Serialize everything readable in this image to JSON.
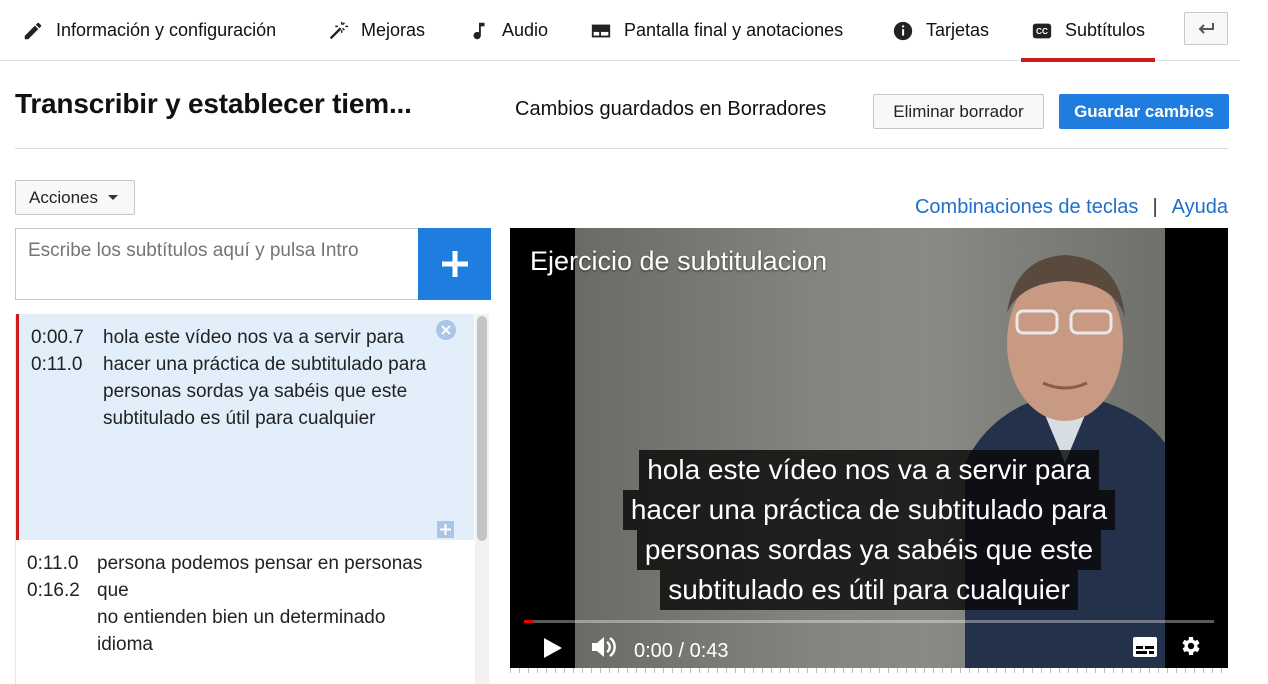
{
  "tabs": [
    {
      "label": "Información y configuración",
      "icon": "pencil-icon"
    },
    {
      "label": "Mejoras",
      "icon": "magic-wand-icon"
    },
    {
      "label": "Audio",
      "icon": "music-note-icon"
    },
    {
      "label": "Pantalla final y anotaciones",
      "icon": "end-screen-icon"
    },
    {
      "label": "Tarjetas",
      "icon": "info-icon"
    },
    {
      "label": "Subtítulos",
      "icon": "cc-icon",
      "active": true
    }
  ],
  "header": {
    "title": "Transcribir y establecer tiem...",
    "status": "Cambios guardados en Borradores",
    "delete_label": "Eliminar borrador",
    "save_label": "Guardar cambios"
  },
  "toolbar": {
    "actions_label": "Acciones",
    "shortcuts_label": "Combinaciones de teclas",
    "separator": "|",
    "help_label": "Ayuda"
  },
  "editor": {
    "placeholder": "Escribe los subtítulos aquí y pulsa Intro"
  },
  "captions": [
    {
      "start": "0:00.7",
      "end": "0:11.0",
      "text": "hola este vídeo nos va a servir para\nhacer una práctica de subtitulado para personas sordas ya sabéis que este subtitulado es útil para cualquier",
      "selected": true
    },
    {
      "start": "0:11.0",
      "end": "0:16.2",
      "text": "persona podemos pensar en personas que\nno entienden bien un determinado idioma",
      "selected": false
    }
  ],
  "player": {
    "video_title": "Ejercicio de subtitulacion",
    "subtitle_lines": [
      "hola este vídeo nos va a servir para",
      "hacer una práctica de subtitulado para",
      "personas sordas ya sabéis que este",
      "subtitulado es útil para cualquier"
    ],
    "time": "0:00 / 0:43",
    "progress_fraction": 0.015
  },
  "colors": {
    "accent_blue": "#1f7de0",
    "active_red": "#cc1b1b",
    "link_blue": "#1f6fc9",
    "selected_bg": "#e2eefa"
  }
}
